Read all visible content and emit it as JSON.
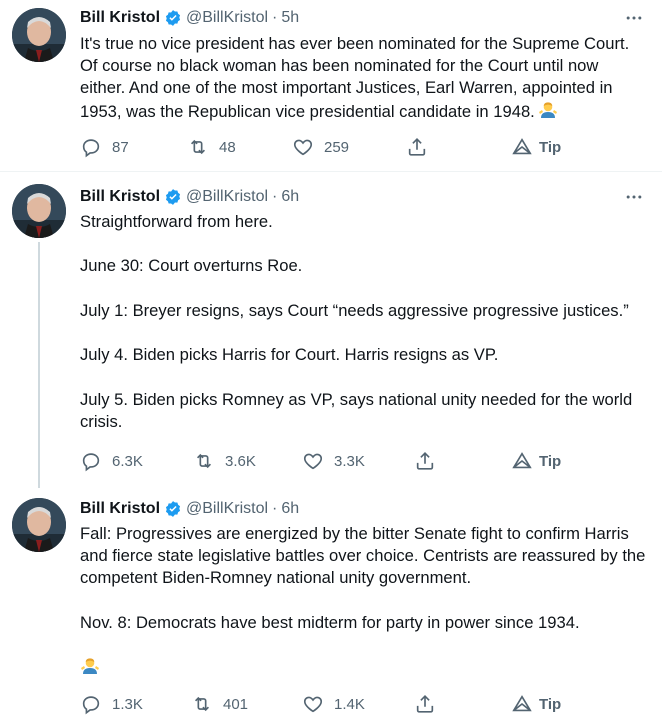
{
  "tweets": [
    {
      "author": "Bill Kristol",
      "handle": "@BillKristol",
      "sep": "·",
      "time": "5h",
      "text": "It's true no vice president has ever been nominated for the Supreme Court. Of course no black woman has been nominated for the Court until now either. And one of the most important Justices, Earl Warren, appointed in 1953, was the Republican vice presidential candidate in 1948.",
      "trailing_emoji": "person-shrugging-emoji",
      "replies": "87",
      "retweets": "48",
      "likes": "259",
      "tip": "Tip"
    },
    {
      "author": "Bill Kristol",
      "handle": "@BillKristol",
      "sep": "·",
      "time": "6h",
      "text": "Straightforward from here.\n\nJune 30: Court overturns Roe.\n\nJuly 1: Breyer resigns, says Court “needs aggressive progressive justices.”\n\nJuly 4. Biden picks Harris for Court. Harris resigns as VP.\n\nJuly 5. Biden picks Romney as VP, says national unity needed for the world crisis.",
      "replies": "6.3K",
      "retweets": "3.6K",
      "likes": "3.3K",
      "tip": "Tip"
    },
    {
      "author": "Bill Kristol",
      "handle": "@BillKristol",
      "sep": "·",
      "time": "6h",
      "text": "Fall: Progressives are energized by the bitter Senate fight to confirm Harris and fierce state legislative battles over choice. Centrists are reassured by the competent Biden-Romney national unity government.\n\nNov. 8: Democrats have best midterm for party in power since 1934.",
      "trailing_emoji": "person-shrugging-emoji",
      "replies": "1.3K",
      "retweets": "401",
      "likes": "1.4K",
      "tip": "Tip"
    }
  ],
  "colors": {
    "text": "#0f1419",
    "secondary": "#536471",
    "verified": "#1d9bf0",
    "divider": "#eff3f4",
    "thread_line": "#cfd9de"
  }
}
